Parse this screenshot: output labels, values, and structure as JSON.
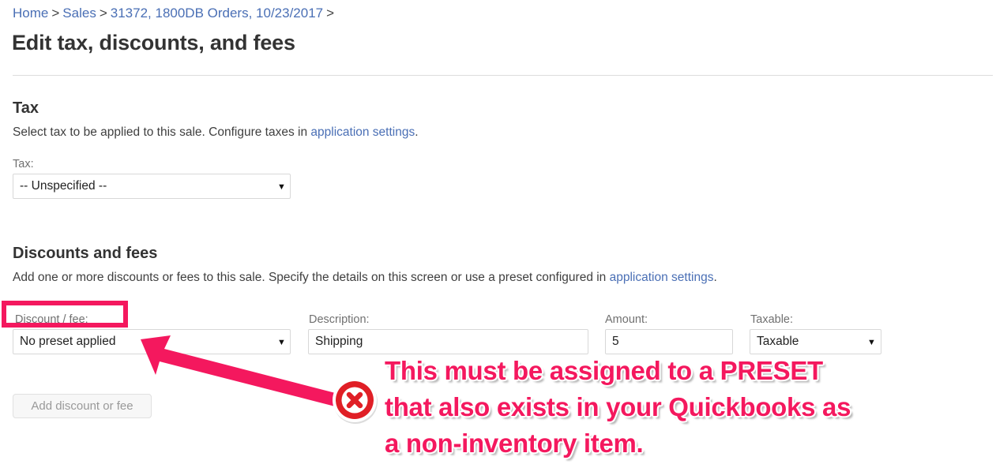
{
  "breadcrumb": {
    "items": [
      {
        "label": "Home",
        "type": "link"
      },
      {
        "label": ">",
        "type": "separator"
      },
      {
        "label": "Sales",
        "type": "link"
      },
      {
        "label": ">",
        "type": "separator"
      },
      {
        "label": "31372, 1800DB Orders, 10/23/2017",
        "type": "link"
      },
      {
        "label": ">",
        "type": "separator"
      }
    ]
  },
  "page": {
    "title": "Edit tax, discounts, and fees"
  },
  "tax_section": {
    "heading": "Tax",
    "description_before": "Select tax to be applied to this sale. Configure taxes in ",
    "description_link": "application settings",
    "description_after": ".",
    "field_label": "Tax:",
    "select_value": "-- Unspecified --",
    "caret": "▼"
  },
  "discounts_section": {
    "heading": "Discounts and fees",
    "description_before": "Add one or more discounts or fees to this sale. Specify the details on this screen or use a preset configured in ",
    "description_link": "application settings",
    "description_after": ".",
    "labels": {
      "discount_fee": "Discount / fee:",
      "description": "Description:",
      "amount": "Amount:",
      "taxable": "Taxable:"
    },
    "values": {
      "discount_fee": "No preset applied",
      "description": "Shipping",
      "amount": "5",
      "taxable": "Taxable"
    },
    "caret": "▼",
    "add_button": "Add discount or fee"
  },
  "annotation": {
    "accent_color": "#f4185e",
    "badge_color": "#e01f26",
    "highlight_target": "Discount / fee:",
    "callout_lines": [
      "This must be assigned to a PRESET",
      "that also exists in your Quickbooks as",
      "a non-inventory item."
    ],
    "badge_icon": "x-circle-icon",
    "arrow_icon": "arrow-pointing-left-icon"
  }
}
